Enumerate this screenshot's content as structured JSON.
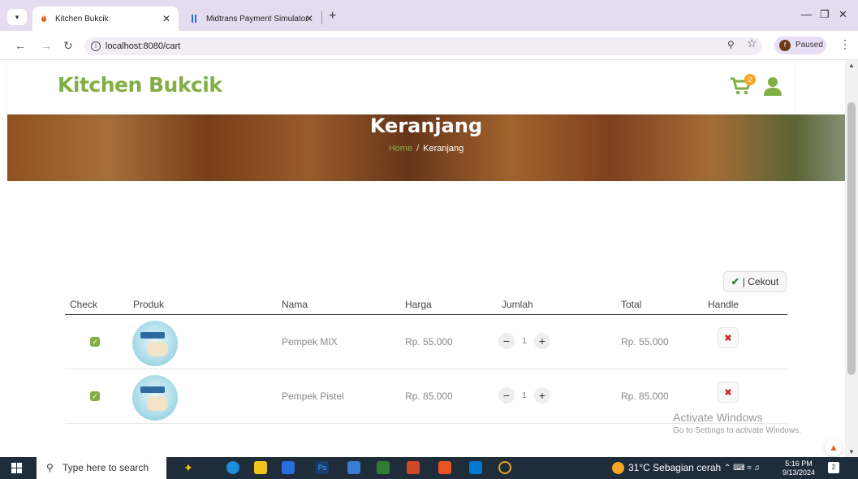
{
  "browser": {
    "tabs": [
      {
        "title": "Kitchen Bukcik",
        "active": true
      },
      {
        "title": "Midtrans Payment Simulator",
        "active": false
      }
    ],
    "url": "localhost:8080/cart",
    "profile_label": "Paused",
    "profile_initial": "f"
  },
  "header": {
    "brand": "Kitchen Bukcik",
    "cart_count": "2"
  },
  "hero": {
    "title": "Keranjang",
    "breadcrumb_home": "Home",
    "breadcrumb_sep": "/",
    "breadcrumb_current": "Keranjang"
  },
  "cart": {
    "checkout_label": "| Cekout",
    "columns": [
      "Check",
      "Produk",
      "Nama",
      "Harga",
      "Jumlah",
      "Total",
      "Handle"
    ],
    "items": [
      {
        "name": "Pempek MIX",
        "price": "Rp. 55.000",
        "qty": "1",
        "total": "Rp. 55.000",
        "checked": true
      },
      {
        "name": "Pempek Pistel",
        "price": "Rp. 85.000",
        "qty": "1",
        "total": "Rp. 85.000",
        "checked": true
      }
    ]
  },
  "watermark": {
    "line1": "Activate Windows",
    "line2": "Go to Settings to activate Windows."
  },
  "taskbar": {
    "search_placeholder": "Type here to search",
    "weather": "31°C  Sebagian cerah",
    "time": "5:16 PM",
    "date": "9/13/2024",
    "notification_count": "2"
  },
  "colors": {
    "brand_green": "#82ae46",
    "badge_orange": "#f5a623",
    "delete_red": "#d32f2f"
  }
}
